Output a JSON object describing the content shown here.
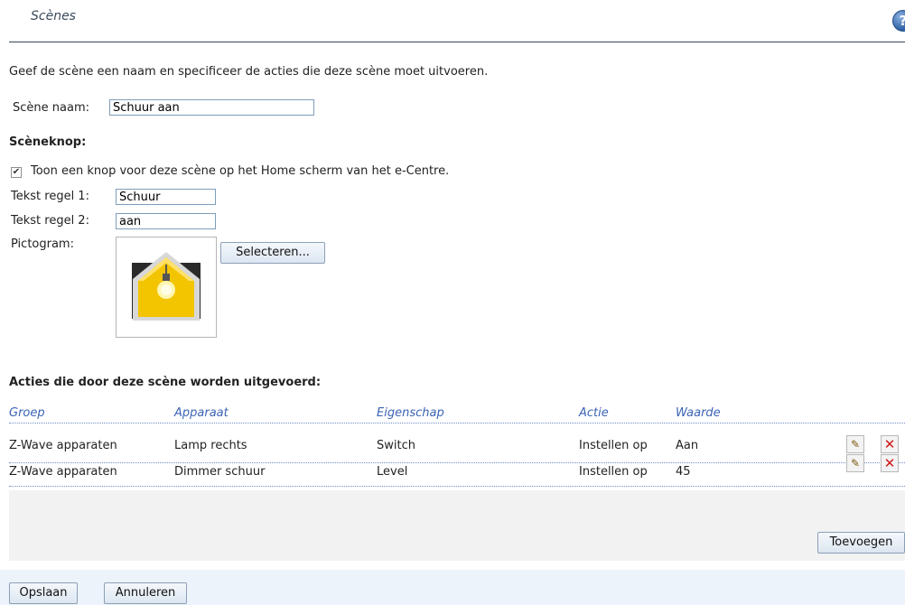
{
  "page": {
    "title": "Scènes",
    "help_symbol": "?",
    "intro": "Geef de scène een naam en specificeer de acties die deze scène moet uitvoeren."
  },
  "scene_name": {
    "label": "Scène naam:",
    "value": "Schuur aan"
  },
  "scene_button": {
    "heading": "Scèneknop:",
    "show_checkbox_checked": true,
    "show_checkbox_label": "Toon een knop voor deze scène op het Home scherm van het e-Centre.",
    "line1_label": "Tekst regel 1:",
    "line1_value": "Schuur",
    "line2_label": "Tekst regel 2:",
    "line2_value": "aan",
    "pictogram_label": "Pictogram:",
    "pictogram_icon": "lightbulb-house-icon",
    "select_button": "Selecteren..."
  },
  "actions": {
    "heading": "Acties die door deze scène worden uitgevoerd:",
    "columns": [
      "Groep",
      "Apparaat",
      "Eigenschap",
      "Actie",
      "Waarde"
    ],
    "rows": [
      {
        "groep": "Z-Wave apparaten",
        "apparaat": "Lamp rechts",
        "eigenschap": "Switch",
        "actie": "Instellen op",
        "waarde": "Aan"
      },
      {
        "groep": "Z-Wave apparaten",
        "apparaat": "Dimmer schuur",
        "eigenschap": "Level",
        "actie": "Instellen op",
        "waarde": "45"
      }
    ],
    "add_button": "Toevoegen"
  },
  "footer": {
    "save_button": "Opslaan",
    "cancel_button": "Annuleren"
  },
  "colors": {
    "header_text": "#3b63b5",
    "delete_icon": "#d01818",
    "title_rule": "#34495e"
  }
}
